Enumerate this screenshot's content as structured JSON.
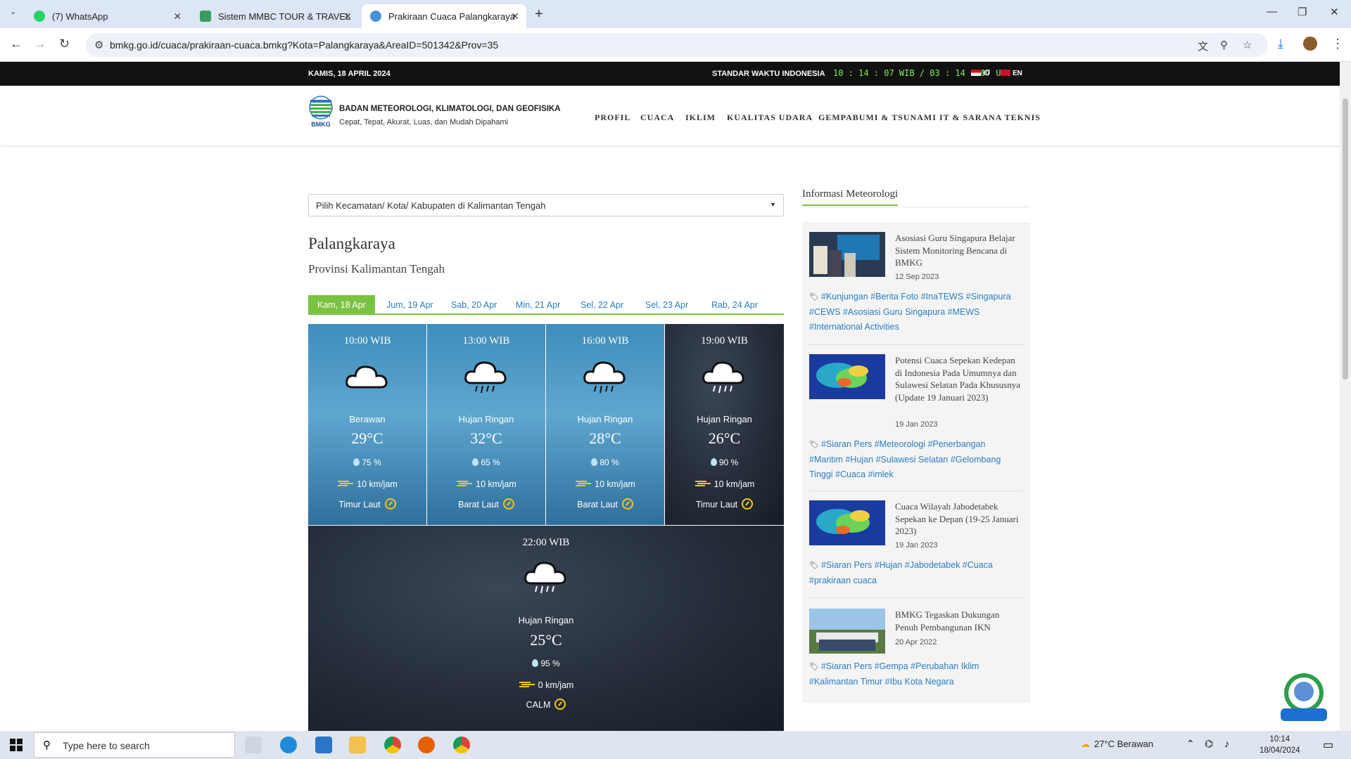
{
  "browser": {
    "tabs": [
      {
        "title": "(7) WhatsApp",
        "favicon_color": "#25d366"
      },
      {
        "title": "Sistem MMBC TOUR & TRAVEL",
        "favicon_color": "#3a9e63"
      },
      {
        "title": "Prakiraan Cuaca Palangkaraya",
        "favicon_color": "#4a90d9"
      }
    ],
    "url": "bmkg.go.id/cuaca/prakiraan-cuaca.bmkg?Kota=Palangkaraya&AreaID=501342&Prov=35"
  },
  "topbar": {
    "date": "KAMIS, 18 APRIL 2024",
    "std_time_label": "STANDAR WAKTU INDONESIA",
    "clock": "10 : 14 : 07 WIB  /  03 : 14 : 07 UTC",
    "lang_id": "ID",
    "lang_en": "EN"
  },
  "header": {
    "logo_text": "BMKG",
    "org_name": "BADAN METEOROLOGI, KLIMATOLOGI, DAN GEOFISIKA",
    "tagline": "Cepat, Tepat, Akurat, Luas, dan Mudah Dipahami",
    "menu": [
      "PROFIL",
      "CUACA",
      "IKLIM",
      "KUALITAS UDARA",
      "GEMPABUMI & TSUNAMI",
      "IT & SARANA TEKNIS"
    ]
  },
  "forecast": {
    "select_placeholder": "Pilih Kecamatan/ Kota/ Kabupaten di Kalimantan Tengah",
    "city": "Palangkaraya",
    "province": "Provinsi Kalimantan Tengah",
    "days": [
      "Kam, 18 Apr",
      "Jum, 19 Apr",
      "Sab, 20 Apr",
      "Min, 21 Apr",
      "Sel, 22 Apr",
      "Sel, 23 Apr",
      "Rab, 24 Apr"
    ],
    "cards": [
      {
        "time": "10:00 WIB",
        "condition": "Berawan",
        "temp": "29°C",
        "humidity": "75 %",
        "wind": "10 km/jam",
        "direction": "Timur Laut",
        "theme": "day",
        "icon": "cloud-icon"
      },
      {
        "time": "13:00 WIB",
        "condition": "Hujan Ringan",
        "temp": "32°C",
        "humidity": "65 %",
        "wind": "10 km/jam",
        "direction": "Barat Laut",
        "theme": "day",
        "icon": "rain-cloud-icon"
      },
      {
        "time": "16:00 WIB",
        "condition": "Hujan Ringan",
        "temp": "28°C",
        "humidity": "80 %",
        "wind": "10 km/jam",
        "direction": "Barat Laut",
        "theme": "day",
        "icon": "rain-cloud-icon"
      },
      {
        "time": "19:00 WIB",
        "condition": "Hujan Ringan",
        "temp": "26°C",
        "humidity": "90 %",
        "wind": "10 km/jam",
        "direction": "Timur Laut",
        "theme": "night",
        "icon": "rain-cloud-icon"
      },
      {
        "time": "22:00 WIB",
        "condition": "Hujan Ringan",
        "temp": "25°C",
        "humidity": "95 %",
        "wind": "0 km/jam",
        "direction": "CALM",
        "theme": "night",
        "icon": "rain-cloud-icon"
      }
    ]
  },
  "sidebar": {
    "heading": "Informasi Meteorologi",
    "news": [
      {
        "title": "Asosiasi Guru Singapura Belajar Sistem Monitoring Bencana di BMKG",
        "date": "12 Sep 2023",
        "tags": "#Kunjungan #Berita Foto #InaTEWS #Singapura #CEWS #Asosiasi Guru Singapura #MEWS #International Activities"
      },
      {
        "title": "Potensi Cuaca Sepekan Kedepan di Indonesia Pada Umumnya dan Sulawesi Selatan Pada Khususnya (Update 19 Januari 2023)",
        "date": "19 Jan 2023",
        "tags": "#Siaran Pers #Meteorologi #Penerbangan #Maritim #Hujan #Sulawesi Selatan #Gelombang Tinggi #Cuaca #imlek"
      },
      {
        "title": "Cuaca Wilayah Jabodetabek Sepekan ke Depan (19-25 Januari 2023)",
        "date": "19 Jan 2023",
        "tags": "#Siaran Pers #Hujan #Jabodetabek #Cuaca #prakiraan cuaca"
      },
      {
        "title": "BMKG Tegaskan Dukungan Penuh Pembangunan IKN",
        "date": "20 Apr 2022",
        "tags": "#Siaran Pers #Gempa #Perubahan Iklim #Kalimantan Timur #Ibu Kota Negara"
      }
    ]
  },
  "taskbar": {
    "search_placeholder": "Type here to search",
    "weather": "27°C  Berawan",
    "time": "10:14",
    "date": "18/04/2024"
  }
}
